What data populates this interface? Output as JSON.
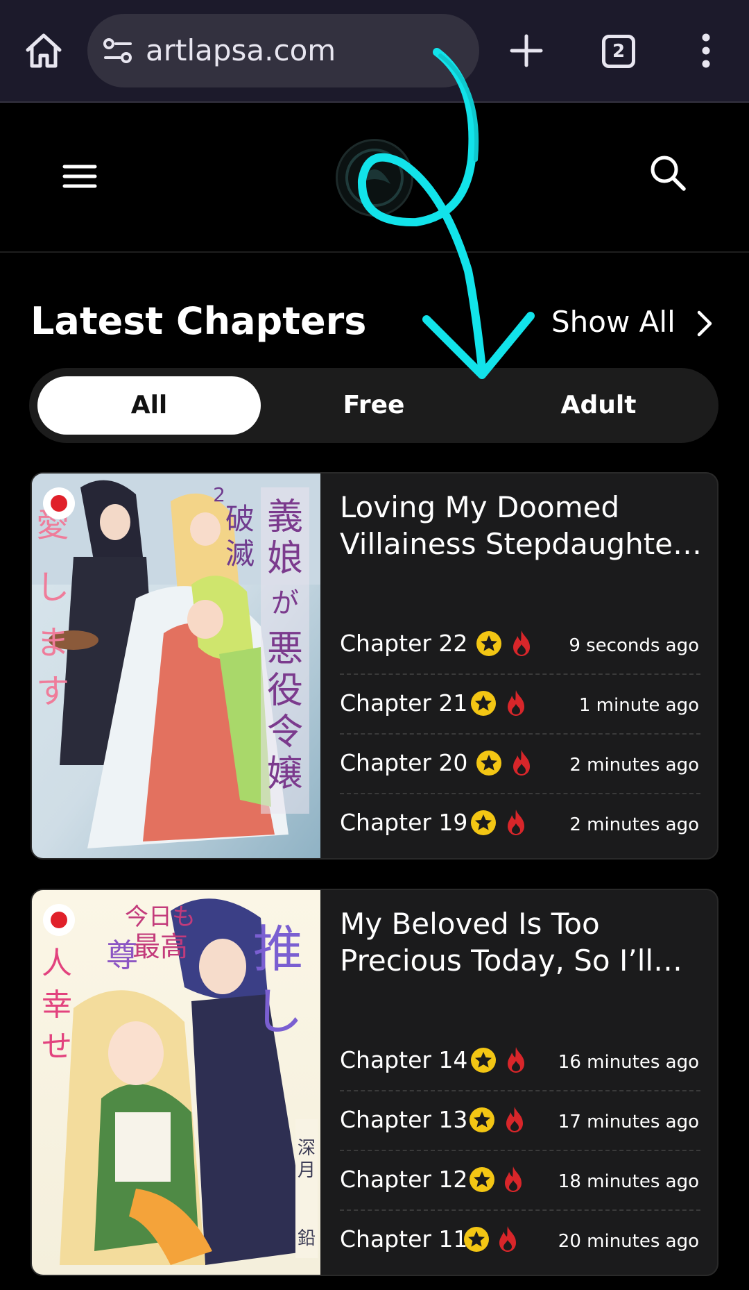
{
  "browser": {
    "url": "artlapsa.com",
    "tab_count": "2"
  },
  "section": {
    "title": "Latest Chapters",
    "show_all": "Show All"
  },
  "filters": [
    {
      "label": "All",
      "active": true
    },
    {
      "label": "Free",
      "active": false
    },
    {
      "label": "Adult",
      "active": false
    }
  ],
  "cards": [
    {
      "title_line1": "Loving My Doomed",
      "title_line2": "Villainess Stepdaughte…",
      "chapters": [
        {
          "label": "Chapter 22",
          "time": "9 seconds ago"
        },
        {
          "label": "Chapter 21",
          "time": "1 minute ago"
        },
        {
          "label": "Chapter 20",
          "time": "2 minutes ago"
        },
        {
          "label": "Chapter 19",
          "time": "2 minutes ago"
        }
      ]
    },
    {
      "title_line1": "My Beloved Is Too",
      "title_line2": "Precious Today, So I’ll…",
      "chapters": [
        {
          "label": "Chapter 14",
          "time": "16 minutes ago"
        },
        {
          "label": "Chapter 13",
          "time": "17 minutes ago"
        },
        {
          "label": "Chapter 12",
          "time": "18 minutes ago"
        },
        {
          "label": "Chapter 11",
          "time": "20 minutes ago"
        }
      ]
    }
  ],
  "icons": {
    "home": "home-icon",
    "site_settings": "site-settings-icon",
    "new_tab": "plus-icon",
    "overflow": "more-vert-icon",
    "hamburger": "menu-icon",
    "search": "search-icon",
    "chevron": "chevron-right-icon",
    "star": "star-icon",
    "fire": "fire-icon",
    "flag": "japan-flag-icon"
  },
  "colors": {
    "browser_bar": "#1c1a2b",
    "card_bg": "#1b1b1c",
    "star": "#f3c614",
    "fire": "#d8262a",
    "annotation": "#12e3ea"
  }
}
